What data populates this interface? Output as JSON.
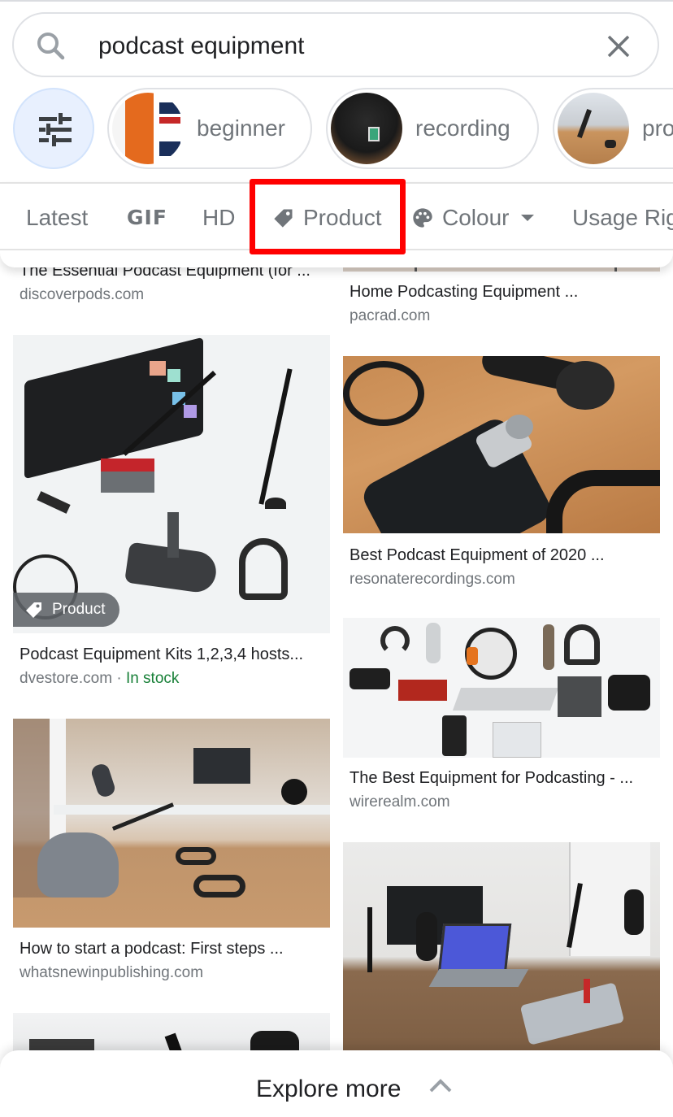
{
  "search": {
    "query": "podcast equipment",
    "icon": "search-icon",
    "clear_icon": "close-icon"
  },
  "chips": {
    "filter_icon": "tune-sliders-icon",
    "items": [
      {
        "label": "beginner"
      },
      {
        "label": "recording"
      },
      {
        "label": "pro"
      }
    ]
  },
  "tools": {
    "items": [
      {
        "label": "Latest"
      },
      {
        "label": "GIF"
      },
      {
        "label": "HD"
      },
      {
        "label": "Product",
        "icon": "tag-icon",
        "highlighted": true
      },
      {
        "label": "Colour",
        "icon": "palette-icon",
        "dropdown": true
      },
      {
        "label": "Usage Rights"
      }
    ],
    "highlight_color": "#ff0000"
  },
  "results": {
    "left": [
      {
        "title": "The Essential Podcast Equipment (for ...",
        "source": "discoverpods.com"
      },
      {
        "title": "Podcast Equipment Kits 1,2,3,4 hosts...",
        "source": "dvestore.com",
        "separator": " · ",
        "stock": "In stock",
        "badge": "Product"
      },
      {
        "title": "How to start a podcast: First steps ...",
        "source": "whatsnewinpublishing.com"
      },
      {
        "title": "",
        "source": ""
      }
    ],
    "right": [
      {
        "title": "Home Podcasting Equipment ...",
        "source": "pacrad.com"
      },
      {
        "title": "Best Podcast Equipment of 2020 ...",
        "source": "resonaterecordings.com"
      },
      {
        "title": "The Best Equipment for Podcasting - ...",
        "source": "wirerealm.com"
      },
      {
        "title": "",
        "source": ""
      }
    ]
  },
  "explore": {
    "label": "Explore more",
    "icon": "chevron-up-icon"
  },
  "colors": {
    "in_stock": "#188038",
    "text_primary": "#202124",
    "text_secondary": "#70757a",
    "filter_bg": "#e8f0fe"
  }
}
